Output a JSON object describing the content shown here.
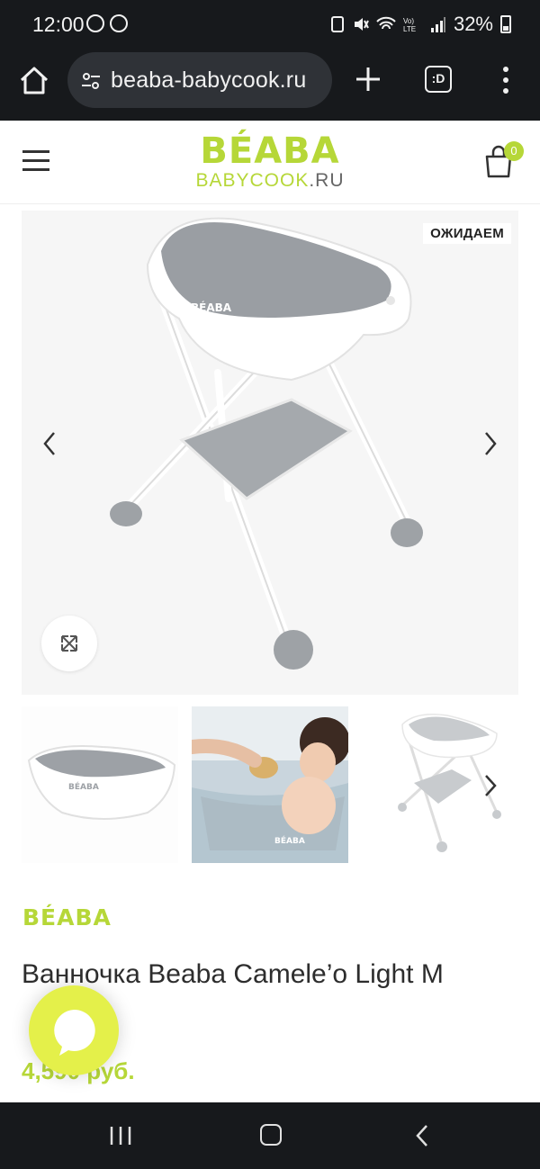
{
  "status_bar": {
    "time": "12:00",
    "battery": "32%"
  },
  "browser": {
    "url": "beaba-babycook.ru",
    "tabs_label": ":D"
  },
  "header": {
    "logo_main": "BÉABA",
    "logo_sub_name": "BABYCOOK",
    "logo_sub_tld": ".RU",
    "cart_count": "0"
  },
  "gallery": {
    "badge": "ОЖИДАЕМ"
  },
  "product": {
    "brand": "BÉABA",
    "title": "Ванночка Beaba Camele’o Light M",
    "price": "4,590 руб."
  },
  "colors": {
    "brand_green": "#b6d738",
    "chat_yellow": "#e4f04a",
    "system_dark": "#17191c"
  }
}
